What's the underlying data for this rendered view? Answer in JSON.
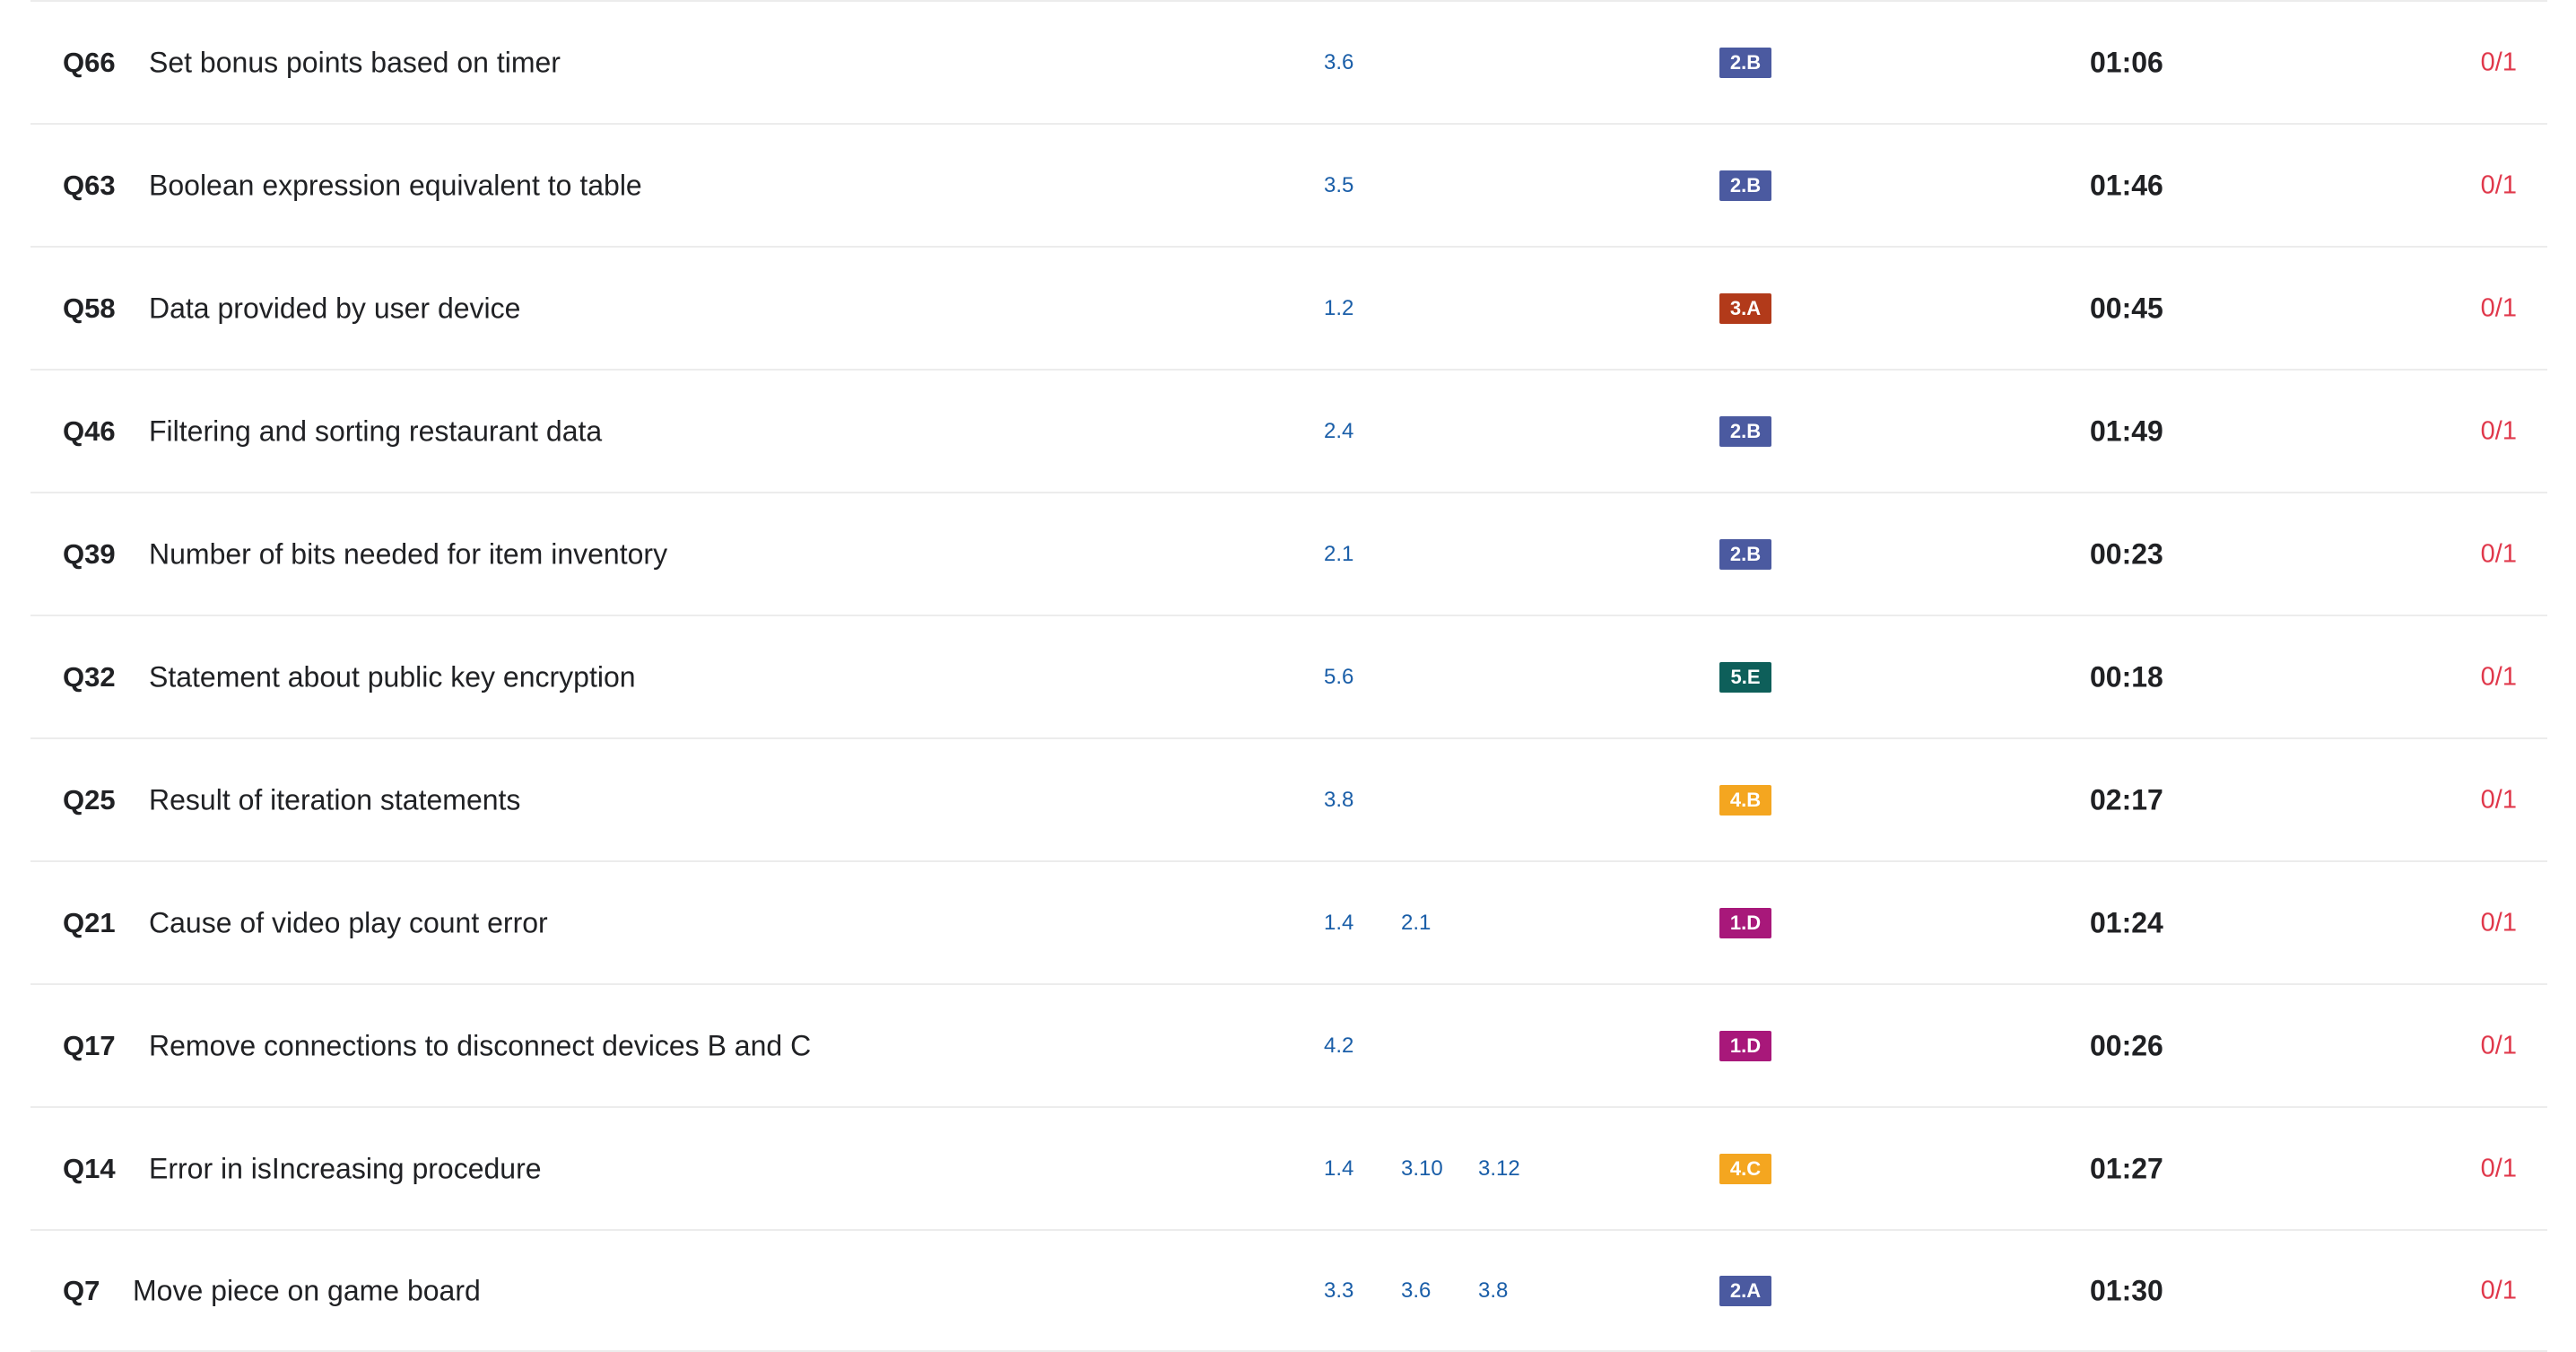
{
  "rows": [
    {
      "num": "Q66",
      "title": "Set bonus points based on timer",
      "topics": [
        "3.6"
      ],
      "skill": "2.B",
      "skill_color": "#4b5aa0",
      "time": "01:06",
      "score": "0/1"
    },
    {
      "num": "Q63",
      "title": "Boolean expression equivalent to table",
      "topics": [
        "3.5"
      ],
      "skill": "2.B",
      "skill_color": "#4b5aa0",
      "time": "01:46",
      "score": "0/1"
    },
    {
      "num": "Q58",
      "title": "Data provided by user device",
      "topics": [
        "1.2"
      ],
      "skill": "3.A",
      "skill_color": "#b23a1a",
      "time": "00:45",
      "score": "0/1"
    },
    {
      "num": "Q46",
      "title": "Filtering and sorting restaurant data",
      "topics": [
        "2.4"
      ],
      "skill": "2.B",
      "skill_color": "#4b5aa0",
      "time": "01:49",
      "score": "0/1"
    },
    {
      "num": "Q39",
      "title": "Number of bits needed for item inventory",
      "topics": [
        "2.1"
      ],
      "skill": "2.B",
      "skill_color": "#4b5aa0",
      "time": "00:23",
      "score": "0/1"
    },
    {
      "num": "Q32",
      "title": "Statement about public key encryption",
      "topics": [
        "5.6"
      ],
      "skill": "5.E",
      "skill_color": "#0e5f5a",
      "time": "00:18",
      "score": "0/1"
    },
    {
      "num": "Q25",
      "title": "Result of iteration statements",
      "topics": [
        "3.8"
      ],
      "skill": "4.B",
      "skill_color": "#f4a620",
      "time": "02:17",
      "score": "0/1"
    },
    {
      "num": "Q21",
      "title": "Cause of video play count error",
      "topics": [
        "1.4",
        "2.1"
      ],
      "skill": "1.D",
      "skill_color": "#a8187a",
      "time": "01:24",
      "score": "0/1"
    },
    {
      "num": "Q17",
      "title": "Remove connections to disconnect devices B and C",
      "topics": [
        "4.2"
      ],
      "skill": "1.D",
      "skill_color": "#a8187a",
      "time": "00:26",
      "score": "0/1"
    },
    {
      "num": "Q14",
      "title": "Error in isIncreasing procedure",
      "topics": [
        "1.4",
        "3.10",
        "3.12"
      ],
      "skill": "4.C",
      "skill_color": "#f4a620",
      "time": "01:27",
      "score": "0/1"
    },
    {
      "num": "Q7",
      "title": "Move piece on game board",
      "topics": [
        "3.3",
        "3.6",
        "3.8"
      ],
      "skill": "2.A",
      "skill_color": "#4b5aa0",
      "time": "01:30",
      "score": "0/1"
    }
  ]
}
